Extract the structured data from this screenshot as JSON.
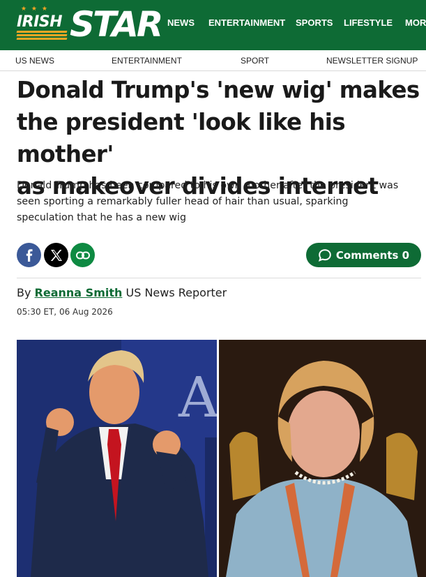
{
  "brand": {
    "name_part1": "IRISH",
    "name_part2": "STAR",
    "stars": "★ ★ ★"
  },
  "main_nav": [
    "NEWS",
    "ENTERTAINMENT",
    "SPORTS",
    "LIFESTYLE",
    "MOR"
  ],
  "sub_nav": [
    "US NEWS",
    "ENTERTAINMENT",
    "SPORT",
    "NEWSLETTER SIGNUP"
  ],
  "article": {
    "headline_line1": "Donald Trump's 'new wig' makes",
    "headline_line2": "the president 'look like his mother'",
    "headline_line3": "as makeover divides internet",
    "standfirst_line1": "Donald Trump has been compared to his own mother after the president was",
    "standfirst_line2": "seen sporting a remarkably fuller head of hair than usual, sparking",
    "standfirst_line3": "speculation that he has a new wig",
    "byline_prefix": "By",
    "author": "Reanna Smith",
    "author_role": "US News Reporter",
    "timestamp": "05:30 ET, 06 Aug 2026"
  },
  "share": {
    "facebook_icon": "facebook-icon",
    "x_icon": "x-icon",
    "link_icon": "link-icon",
    "comments_label": "Comments 0"
  },
  "hero_image": {
    "left_backdrop_text": "A",
    "colors": {
      "left_bg": "#1d2f72",
      "right_bg": "#2a1a10",
      "suit": "#1e2a4a",
      "tie": "#c4141f",
      "cardigan": "#8fb2c8"
    }
  },
  "colors": {
    "brand_green": "#0e6b35",
    "facebook": "#3b5998",
    "x": "#000000",
    "link": "#0e8a42",
    "gold": "#f5a623"
  }
}
